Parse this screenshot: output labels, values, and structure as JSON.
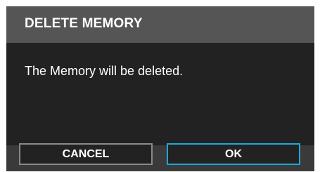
{
  "dialog": {
    "title": "DELETE MEMORY",
    "message": "The Memory will be deleted.",
    "cancel_label": "CANCEL",
    "ok_label": "OK"
  },
  "colors": {
    "header_bg": "#555555",
    "body_bg": "#222222",
    "ok_border": "#1aa8d8",
    "cancel_border": "#8a8a8a"
  }
}
